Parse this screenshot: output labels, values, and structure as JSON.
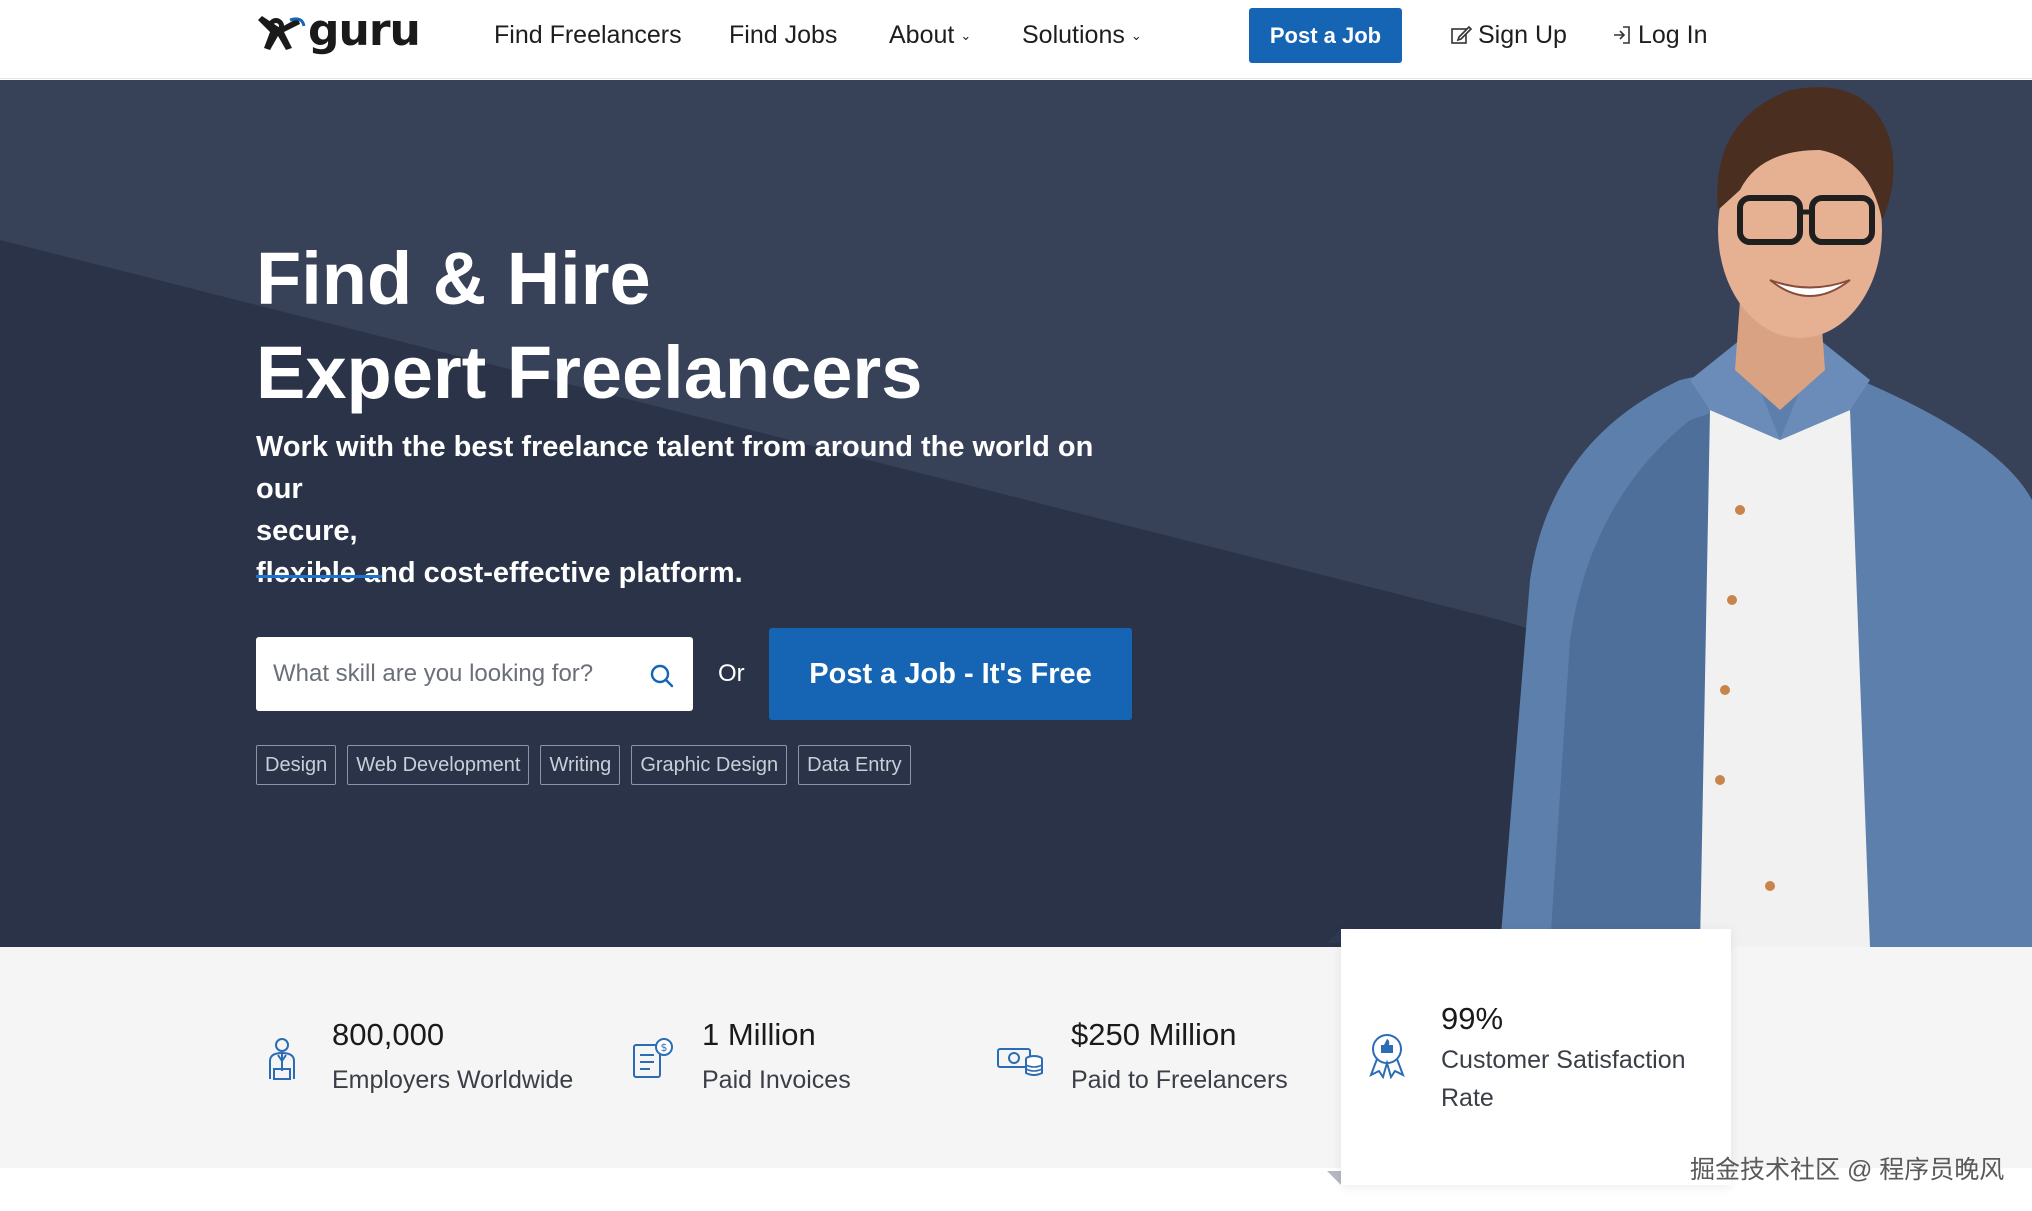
{
  "header": {
    "logo_text": "guru",
    "nav": [
      {
        "label": "Find Freelancers"
      },
      {
        "label": "Find Jobs"
      },
      {
        "label": "About"
      },
      {
        "label": "Solutions"
      }
    ],
    "post_job_label": "Post a Job",
    "signup_label": "Sign Up",
    "login_label": "Log In"
  },
  "hero": {
    "title_line1": "Find & Hire",
    "title_line2": "Expert Freelancers",
    "subtitle_line1": "Work with the best freelance talent from around the world on our",
    "subtitle_line2": "secure,",
    "subtitle_line3": "flexible and cost-effective platform.",
    "search_placeholder": "What skill are you looking for?",
    "or_text": "Or",
    "cta_label": "Post a Job - It's Free",
    "tags": [
      "Design",
      "Web Development",
      "Writing",
      "Graphic Design",
      "Data Entry"
    ]
  },
  "stats": [
    {
      "value": "800,000",
      "label": "Employers Worldwide",
      "icon": "employer-icon"
    },
    {
      "value": "1 Million",
      "label": "Paid Invoices",
      "icon": "invoice-icon"
    },
    {
      "value": "$250 Million",
      "label": "Paid to Freelancers",
      "icon": "money-icon"
    },
    {
      "value": "99%",
      "label_line1": "Customer Satisfaction",
      "label_line2": "Rate",
      "icon": "award-icon"
    }
  ],
  "watermark": "掘金技术社区 @ 程序员晚风",
  "colors": {
    "brand_blue": "#1565b4",
    "hero_bg": "#374158",
    "hero_dark": "#2a3348",
    "stats_bg": "#f5f5f5",
    "icon_blue": "#2b6cb5"
  }
}
